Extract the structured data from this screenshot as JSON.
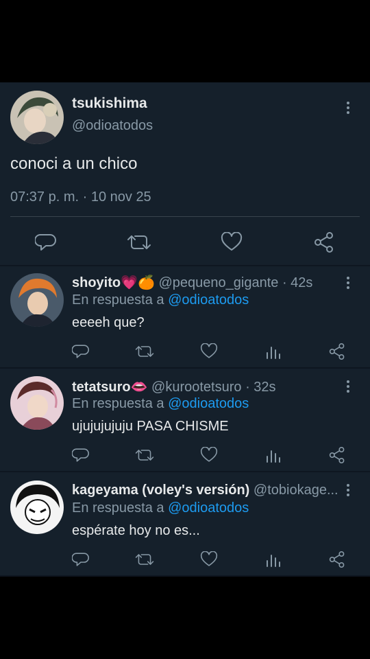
{
  "main_tweet": {
    "display_name": "tsukishima",
    "handle": "@odioatodos",
    "text": "conoci a un chico",
    "timestamp": "07:37 p. m. · 10 nov 25"
  },
  "replies": [
    {
      "display_name": "shoyito",
      "name_emoji": "💗🍊",
      "handle_time": "@pequeno_gigante · 42s",
      "reply_prefix": "En respuesta a",
      "reply_to": "@odioatodos",
      "text": "eeeeh que?"
    },
    {
      "display_name": "tetatsuro",
      "name_emoji": "👄",
      "handle_time": "@kurootetsuro · 32s",
      "reply_prefix": "En respuesta a",
      "reply_to": "@odioatodos",
      "text": "ujujujujuju PASA CHISME"
    },
    {
      "display_name": "kageyama (voley's versión)",
      "name_emoji": "",
      "handle_time": "@tobiokage...",
      "reply_prefix": "En respuesta a",
      "reply_to": "@odioatodos",
      "text": "espérate hoy no es..."
    }
  ],
  "icons": {
    "reply": "reply-icon",
    "retweet": "retweet-icon",
    "like": "heart-icon",
    "stats": "stats-icon",
    "share": "share-icon",
    "more": "more-vertical-icon"
  },
  "colors": {
    "background": "#15202b",
    "accent": "#1d9bf0",
    "muted": "#8899a6",
    "text": "#e7e9ea"
  }
}
